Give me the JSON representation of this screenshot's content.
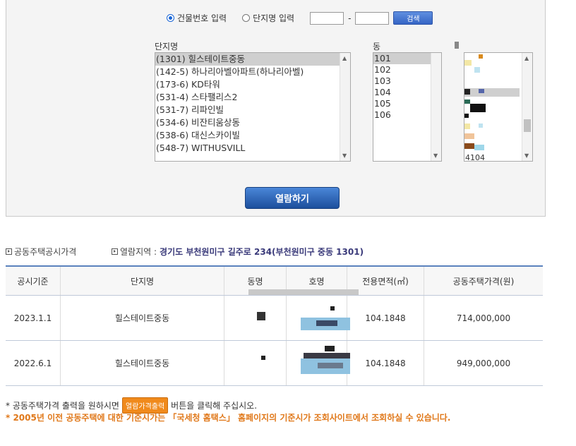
{
  "search": {
    "radio_building": "건물번호 입력",
    "radio_complex": "단지명 입력",
    "dash": "-",
    "search_button": "검색"
  },
  "lists": {
    "complex_label": "단지명",
    "dong_label": "동",
    "complex_items": [
      "(1301) 힐스테이트중동",
      "(142-5) 하나리아벨아파트(하나리아벨)",
      "(173-6) KD타워",
      "(531-4) 스타팰리스2",
      "(531-7) 리파인빌",
      "(534-6) 비잔티움상동",
      "(538-6) 대신스카이빌",
      "(548-7) WITHUSVILL"
    ],
    "dong_items": [
      "101",
      "102",
      "103",
      "104",
      "105",
      "106"
    ],
    "ho_partial": "4104"
  },
  "view_button": "열람하기",
  "info": {
    "section_title": "공동주택공시가격",
    "region_label": "열람지역 :",
    "region_value": "경기도 부천원미구 길주로 234(부천원미구 중동 1301)"
  },
  "table": {
    "headers": [
      "공시기준",
      "단지명",
      "동명",
      "호명",
      "전용면적(㎡)",
      "공동주택가격(원)"
    ],
    "rows": [
      {
        "date": "2023.1.1",
        "complex": "힐스테이트중동",
        "area": "104.1848",
        "price": "714,000,000"
      },
      {
        "date": "2022.6.1",
        "complex": "힐스테이트중동",
        "area": "104.1848",
        "price": "949,000,000"
      }
    ]
  },
  "notes": {
    "note1_prefix": "* 공동주택가격 출력을 원하시면",
    "print_button": "열람가격출력",
    "note1_suffix": "버튼을 클릭해 주십시오.",
    "note2": "* 2005년 이전 공동주택에 대한 기준시가는 「국세청 홈택스」 홈페이지의 기준시가 조회사이트에서 조회하실 수 있습니다."
  },
  "colors": {
    "accent_blue": "#3565c5",
    "orange": "#f08a1c",
    "note_orange": "#e0781a"
  }
}
